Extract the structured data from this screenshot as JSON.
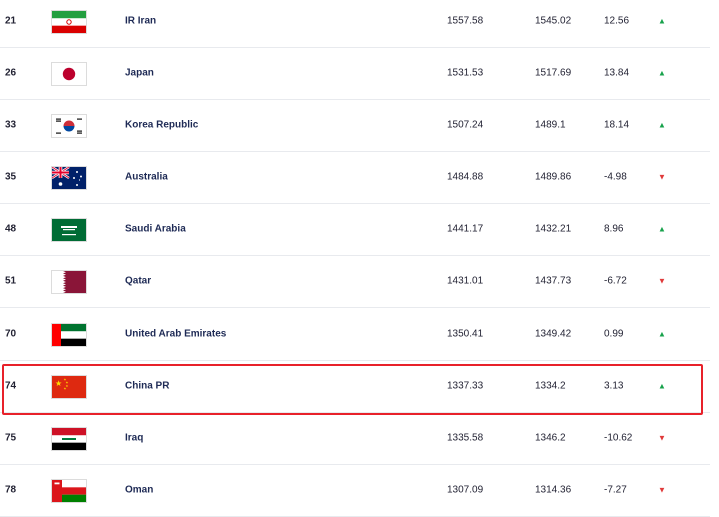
{
  "rankings": [
    {
      "rank": "21",
      "flag": "iran-flag-icon",
      "team": "IR Iran",
      "total_points": "1557.58",
      "previous_points": "1545.02",
      "change": "12.56",
      "trend": "up"
    },
    {
      "rank": "26",
      "flag": "japan-flag-icon",
      "team": "Japan",
      "total_points": "1531.53",
      "previous_points": "1517.69",
      "change": "13.84",
      "trend": "up"
    },
    {
      "rank": "33",
      "flag": "korea-flag-icon",
      "team": "Korea Republic",
      "total_points": "1507.24",
      "previous_points": "1489.1",
      "change": "18.14",
      "trend": "up"
    },
    {
      "rank": "35",
      "flag": "australia-flag-icon",
      "team": "Australia",
      "total_points": "1484.88",
      "previous_points": "1489.86",
      "change": "-4.98",
      "trend": "down"
    },
    {
      "rank": "48",
      "flag": "saudi-arabia-flag-icon",
      "team": "Saudi Arabia",
      "total_points": "1441.17",
      "previous_points": "1432.21",
      "change": "8.96",
      "trend": "up"
    },
    {
      "rank": "51",
      "flag": "qatar-flag-icon",
      "team": "Qatar",
      "total_points": "1431.01",
      "previous_points": "1437.73",
      "change": "-6.72",
      "trend": "down"
    },
    {
      "rank": "70",
      "flag": "uae-flag-icon",
      "team": "United Arab Emirates",
      "total_points": "1350.41",
      "previous_points": "1349.42",
      "change": "0.99",
      "trend": "up"
    },
    {
      "rank": "74",
      "flag": "china-flag-icon",
      "team": "China PR",
      "total_points": "1337.33",
      "previous_points": "1334.2",
      "change": "3.13",
      "trend": "up"
    },
    {
      "rank": "75",
      "flag": "iraq-flag-icon",
      "team": "Iraq",
      "total_points": "1335.58",
      "previous_points": "1346.2",
      "change": "-10.62",
      "trend": "down"
    },
    {
      "rank": "78",
      "flag": "oman-flag-icon",
      "team": "Oman",
      "total_points": "1307.09",
      "previous_points": "1314.36",
      "change": "-7.27",
      "trend": "down"
    }
  ],
  "highlighted_team": "China PR",
  "colors": {
    "trend_up": "#18a24c",
    "trend_down": "#e03a3a",
    "highlight_border": "#e8212a"
  },
  "icons": {
    "up": "▲",
    "down": "▼"
  }
}
